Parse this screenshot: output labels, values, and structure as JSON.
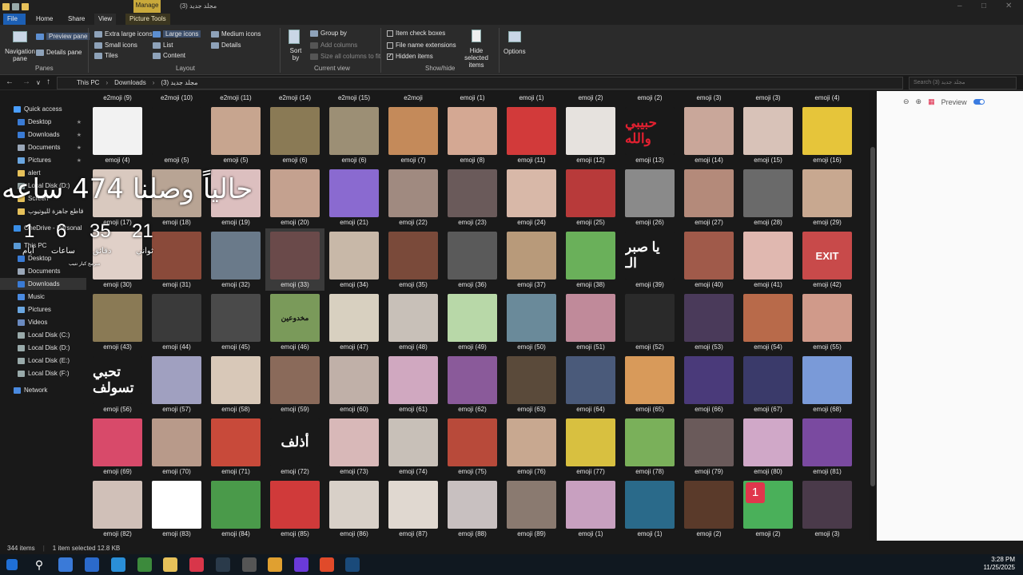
{
  "window": {
    "title": "مجلد جديد (3)",
    "manage_tab": "Manage"
  },
  "ribbon_tabs": [
    "File",
    "Home",
    "Share",
    "View",
    "Picture Tools"
  ],
  "ribbon": {
    "navigation_pane": "Navigation pane",
    "preview_pane": "Preview pane",
    "details_pane": "Details pane",
    "panes_label": "Panes",
    "layout_items": [
      "Extra large icons",
      "Large icons",
      "Medium icons",
      "Small icons",
      "List",
      "Details",
      "Tiles",
      "Content"
    ],
    "layout_selected": "Large icons",
    "layout_label": "Layout",
    "sort_by": "Sort by",
    "group_by": "Group by",
    "add_columns": "Add columns",
    "size_columns": "Size all columns to fit",
    "current_view_label": "Current view",
    "item_check_boxes": "Item check boxes",
    "file_name_extensions": "File name extensions",
    "hidden_items": "Hidden items",
    "hide_selected": "Hide selected items",
    "show_hide_label": "Show/hide",
    "options": "Options"
  },
  "address": {
    "crumbs": [
      "This PC",
      "Downloads",
      "مجلد جديد (3)"
    ],
    "search_placeholder": "Search مجلد جديد (3)"
  },
  "nav": [
    {
      "label": "Quick access",
      "color": "#4a9eff"
    },
    {
      "label": "Desktop",
      "color": "#3a7bd5",
      "pin": true
    },
    {
      "label": "Downloads",
      "color": "#3a7bd5",
      "pin": true
    },
    {
      "label": "Documents",
      "color": "#9aa7b8",
      "pin": true
    },
    {
      "label": "Pictures",
      "color": "#6aa6e0",
      "pin": true
    },
    {
      "label": "alert",
      "color": "#e6c15a"
    },
    {
      "label": "Local Disk (D:)",
      "color": "#9aa"
    },
    {
      "label": "Screen",
      "color": "#e6c15a"
    },
    {
      "label": "قاطع جاهزة لليوتيوب",
      "color": "#e6c15a"
    },
    {
      "label": "OneDrive - Personal",
      "color": "#3a8ee6"
    },
    {
      "label": "This PC",
      "color": "#5a9ad5"
    },
    {
      "label": "Desktop",
      "color": "#3a7bd5"
    },
    {
      "label": "Documents",
      "color": "#9aa7b8"
    },
    {
      "label": "Downloads",
      "color": "#3a7bd5"
    },
    {
      "label": "Music",
      "color": "#4a8ae0"
    },
    {
      "label": "Pictures",
      "color": "#6aa6e0"
    },
    {
      "label": "Videos",
      "color": "#6a8ac0"
    },
    {
      "label": "Local Disk (C:)",
      "color": "#9aa"
    },
    {
      "label": "Local Disk (D:)",
      "color": "#9aa"
    },
    {
      "label": "Local Disk (E:)",
      "color": "#9aa"
    },
    {
      "label": "Local Disk (F:)",
      "color": "#9aa"
    },
    {
      "label": "Network",
      "color": "#4a8ae0"
    }
  ],
  "top_row_labels": [
    "e2moji (9)",
    "e2moji (10)",
    "e2moji (11)",
    "e2moji (14)",
    "e2moji (15)",
    "e2moji",
    "emoji (1)",
    "emoji (1)",
    "emoji (2)",
    "emoji (2)",
    "emoji (3)",
    "emoji (3)",
    "emoji (4)"
  ],
  "grid_rows": [
    [
      "emoji (4)",
      "emoji (5)",
      "emoji (5)",
      "emoji (6)",
      "emoji (6)",
      "emoji (7)",
      "emoji (8)",
      "emoji (11)",
      "emoji (12)",
      "emoji (13)",
      "emoji (14)",
      "emoji (15)",
      "emoji (16)"
    ],
    [
      "emoji (17)",
      "emoji (18)",
      "emoji (19)",
      "emoji (20)",
      "emoji (21)",
      "emoji (22)",
      "emoji (23)",
      "emoji (24)",
      "emoji (25)",
      "emoji (26)",
      "emoji (27)",
      "emoji (28)",
      "emoji (29)"
    ],
    [
      "emoji (30)",
      "emoji (31)",
      "emoji (32)",
      "emoji (33)",
      "emoji (34)",
      "emoji (35)",
      "emoji (36)",
      "emoji (37)",
      "emoji (38)",
      "emoji (39)",
      "emoji (40)",
      "emoji (41)",
      "emoji (42)"
    ],
    [
      "emoji (43)",
      "emoji (44)",
      "emoji (45)",
      "emoji (46)",
      "emoji (47)",
      "emoji (48)",
      "emoji (49)",
      "emoji (50)",
      "emoji (51)",
      "emoji (52)",
      "emoji (53)",
      "emoji (54)",
      "emoji (55)"
    ],
    [
      "emoji (56)",
      "emoji (57)",
      "emoji (58)",
      "emoji (59)",
      "emoji (60)",
      "emoji (61)",
      "emoji (62)",
      "emoji (63)",
      "emoji (64)",
      "emoji (65)",
      "emoji (66)",
      "emoji (67)",
      "emoji (68)"
    ],
    [
      "emoji (69)",
      "emoji (70)",
      "emoji (71)",
      "emoji (72)",
      "emoji (73)",
      "emoji (74)",
      "emoji (75)",
      "emoji (76)",
      "emoji (77)",
      "emoji (78)",
      "emoji (79)",
      "emoji (80)",
      "emoji (81)"
    ],
    [
      "emoji (82)",
      "emoji (83)",
      "emoji (84)",
      "emoji (85)",
      "emoji (86)",
      "emoji (87)",
      "emoji (88)",
      "emoji (89)",
      "emoji (1)",
      "emoji (1)",
      "emoji (2)",
      "emoji (2)",
      "emoji (3)"
    ]
  ],
  "thumb_colors": [
    [
      "#f2f2f2",
      "#191919",
      "#c7a58f",
      "#8a7a55",
      "#9c8f75",
      "#c48a5a",
      "#d4a893",
      "#d23a3a",
      "#e6e2de",
      "#191919",
      "#c9a79a",
      "#d8c2b8",
      "#e6c53a"
    ],
    [
      "#d9c9bf",
      "#b8a494",
      "#dcbfbf",
      "#c4a18f",
      "#8a6ad0",
      "#a08a80",
      "#6a5a5a",
      "#d8b8a8",
      "#b83a3a",
      "#8a8a8a",
      "#b48a7a",
      "#6a6a6a",
      "#c8a890"
    ],
    [
      "#e0d0c8",
      "#8a4a3a",
      "#6a7a8a",
      "#6a4a4a",
      "#c8b8a8",
      "#7a4a3a",
      "#5a5a5a",
      "#b89a7a",
      "#6ab05a",
      "#191919",
      "#a05a4a",
      "#e0b8b0",
      "#c84a4a"
    ],
    [
      "#8a7a55",
      "#3a3a3a",
      "#4a4a4a",
      "#2a2a2a",
      "#d8d0c0",
      "#c8c0b8",
      "#b8d8a8",
      "#6a8a9a",
      "#c08a9a",
      "#2a2a2a",
      "#4a3a5a",
      "#b86a4a",
      "#d09a8a"
    ],
    [
      "#191919",
      "#a0a0c0",
      "#d8c8b8",
      "#8a6a5a",
      "#c0b0a8",
      "#d0a8c0",
      "#8a5a9a",
      "#5a4a3a",
      "#4a5a7a",
      "#d89a5a",
      "#4a3a7a",
      "#3a3a6a",
      "#7a9ad8"
    ],
    [
      "#d84a6a",
      "#b89a8a",
      "#c84a3a",
      "#191919",
      "#d8b8b8",
      "#c8c0b8",
      "#b84a3a",
      "#c8a890",
      "#d8c040",
      "#7ab05a",
      "#6a5a5a",
      "#d0a8c8",
      "#7a4aa0"
    ],
    [
      "#d0c0b8",
      "#ffffff",
      "#4a9a4a",
      "#d03a3a",
      "#d8d0c8",
      "#e0d8d0",
      "#c8c0c0",
      "#8a7a70",
      "#c8a0c0",
      "#2a6a8a",
      "#5a3a2a",
      "#4ab05a",
      "#4a3a4a"
    ]
  ],
  "thumb_text": {
    "r0c9": "حبيبي والله",
    "r2c9": "يا صبر الـ",
    "r2c12": "EXIT",
    "r3c3": "مخدوعين",
    "r4c0": "تحبي تسولف",
    "r5c3": "أذلف"
  },
  "selected_cell": "emoji (33)",
  "preview": {
    "label": "Preview"
  },
  "status": {
    "count": "344 items",
    "selected": "1 item selected  12.8 KB"
  },
  "taskbar": {
    "time": "3:28 PM",
    "date": "11/25/2025"
  },
  "overlay": {
    "big_text": "حالياً وصلنا 474 ساعه",
    "hours_value": "21",
    "minutes_value": "35",
    "seconds_value": "6",
    "days_value": "1",
    "label_seconds": "ثواني",
    "label_minutes": "دقائق",
    "label_hours": "ساعات",
    "label_days": "أيام",
    "small_line": "مبرمج كبار نتيب",
    "badge": "1"
  }
}
